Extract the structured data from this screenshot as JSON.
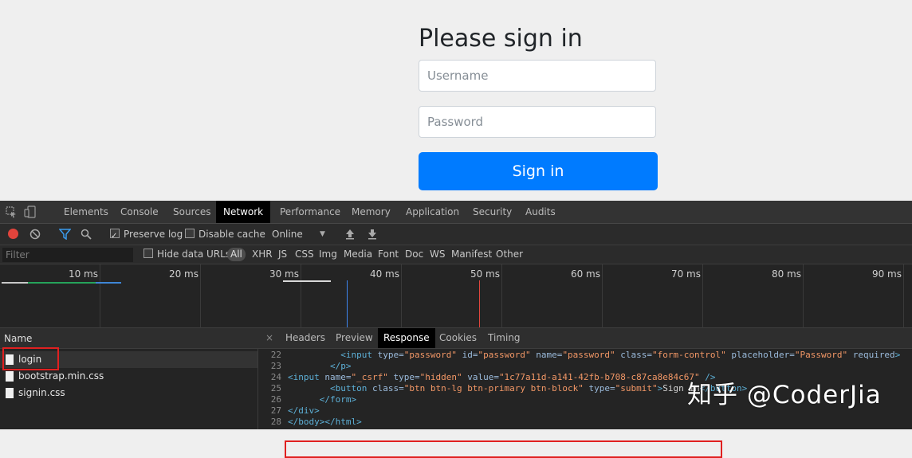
{
  "page": {
    "title": "Please sign in",
    "username_placeholder": "Username",
    "password_placeholder": "Password",
    "signin_button": "Sign in",
    "colors": {
      "primary": "#007bff",
      "background": "#efefef"
    }
  },
  "devtools": {
    "tabs": [
      "Elements",
      "Console",
      "Sources",
      "Network",
      "Performance",
      "Memory",
      "Application",
      "Security",
      "Audits"
    ],
    "active_tab": "Network",
    "toolbar": {
      "preserve_log": "Preserve log",
      "preserve_log_checked": true,
      "disable_cache": "Disable cache",
      "disable_cache_checked": false,
      "throttle": "Online"
    },
    "filter": {
      "placeholder": "Filter",
      "hide_data_urls": "Hide data URLs",
      "types": [
        "All",
        "XHR",
        "JS",
        "CSS",
        "Img",
        "Media",
        "Font",
        "Doc",
        "WS",
        "Manifest",
        "Other"
      ],
      "active_type": "All"
    },
    "timeline": {
      "ticks": [
        "10 ms",
        "20 ms",
        "30 ms",
        "40 ms",
        "50 ms",
        "60 ms",
        "70 ms",
        "80 ms",
        "90 ms"
      ]
    },
    "requests": {
      "header": "Name",
      "items": [
        "login",
        "bootstrap.min.css",
        "signin.css"
      ],
      "selected": "login"
    },
    "detail": {
      "close": "×",
      "tabs": [
        "Headers",
        "Preview",
        "Response",
        "Cookies",
        "Timing"
      ],
      "active_tab": "Response",
      "lines": [
        {
          "num": "22",
          "indent": "          ",
          "parts": [
            [
              "tag",
              "<input "
            ],
            [
              "attr",
              "type="
            ],
            [
              "val",
              "\"password\""
            ],
            [
              "attr",
              " id="
            ],
            [
              "val",
              "\"password\""
            ],
            [
              "attr",
              " name="
            ],
            [
              "val",
              "\"password\""
            ],
            [
              "attr",
              " class="
            ],
            [
              "val",
              "\"form-control\""
            ],
            [
              "attr",
              " placeholder="
            ],
            [
              "val",
              "\"Password\""
            ],
            [
              "attr",
              " required"
            ],
            [
              "tag",
              ">"
            ]
          ]
        },
        {
          "num": "23",
          "indent": "        ",
          "parts": [
            [
              "tag",
              "</p>"
            ]
          ]
        },
        {
          "num": "24",
          "indent": "",
          "parts": [
            [
              "tag",
              "<input "
            ],
            [
              "attr",
              "name="
            ],
            [
              "val",
              "\"_csrf\""
            ],
            [
              "attr",
              " type="
            ],
            [
              "val",
              "\"hidden\""
            ],
            [
              "attr",
              " value="
            ],
            [
              "val",
              "\"1c77a11d-a141-42fb-b708-c87ca8e84c67\""
            ],
            [
              "tag",
              " />"
            ]
          ]
        },
        {
          "num": "25",
          "indent": "        ",
          "parts": [
            [
              "tag",
              "<button "
            ],
            [
              "attr",
              "class="
            ],
            [
              "val",
              "\"btn btn-lg btn-primary btn-block\""
            ],
            [
              "attr",
              " type="
            ],
            [
              "val",
              "\"submit\""
            ],
            [
              "tag",
              ">"
            ],
            [
              "txt",
              "Sign in"
            ],
            [
              "tag",
              "</button>"
            ]
          ]
        },
        {
          "num": "26",
          "indent": "      ",
          "parts": [
            [
              "tag",
              "</form>"
            ]
          ]
        },
        {
          "num": "27",
          "indent": "",
          "parts": [
            [
              "tag",
              "</div>"
            ]
          ]
        },
        {
          "num": "28",
          "indent": "",
          "parts": [
            [
              "tag",
              "</body></html>"
            ]
          ]
        }
      ]
    }
  },
  "watermark": "知乎 @CoderJia"
}
